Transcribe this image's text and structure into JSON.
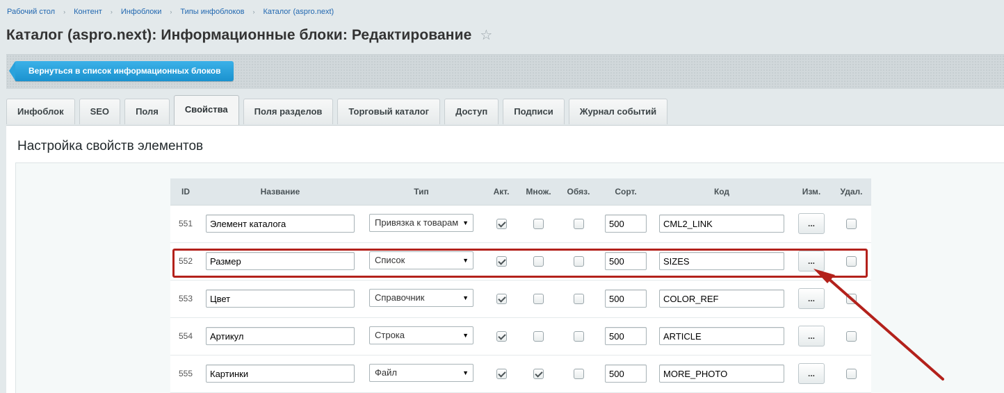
{
  "breadcrumb": [
    "Рабочий стол",
    "Контент",
    "Инфоблоки",
    "Типы инфоблоков",
    "Каталог (aspro.next)"
  ],
  "breadcrumb_separator": "›",
  "title": "Каталог (aspro.next): Информационные блоки: Редактирование",
  "favorite_icon": "☆",
  "toolbar": {
    "back_label": "Вернуться в список информационных блоков"
  },
  "tabs": [
    {
      "label": "Инфоблок"
    },
    {
      "label": "SEO"
    },
    {
      "label": "Поля"
    },
    {
      "label": "Свойства",
      "active": true
    },
    {
      "label": "Поля разделов"
    },
    {
      "label": "Торговый каталог"
    },
    {
      "label": "Доступ"
    },
    {
      "label": "Подписи"
    },
    {
      "label": "Журнал событий"
    }
  ],
  "section_title": "Настройка свойств элементов",
  "table": {
    "headers": {
      "id": "ID",
      "name": "Название",
      "type": "Тип",
      "active": "Акт.",
      "multiple": "Множ.",
      "required": "Обяз.",
      "sort": "Сорт.",
      "code": "Код",
      "edit": "Изм.",
      "delete": "Удал."
    },
    "edit_button_label": "...",
    "rows": [
      {
        "id": "551",
        "name": "Элемент каталога",
        "type": "Привязка к товарам",
        "active": true,
        "multiple": false,
        "required": false,
        "sort": "500",
        "code": "CML2_LINK"
      },
      {
        "id": "552",
        "name": "Размер",
        "type": "Список",
        "active": true,
        "multiple": false,
        "required": false,
        "sort": "500",
        "code": "SIZES",
        "highlighted": true
      },
      {
        "id": "553",
        "name": "Цвет",
        "type": "Справочник",
        "active": true,
        "multiple": false,
        "required": false,
        "sort": "500",
        "code": "COLOR_REF"
      },
      {
        "id": "554",
        "name": "Артикул",
        "type": "Строка",
        "active": true,
        "multiple": false,
        "required": false,
        "sort": "500",
        "code": "ARTICLE"
      },
      {
        "id": "555",
        "name": "Картинки",
        "type": "Файл",
        "active": true,
        "multiple": true,
        "required": false,
        "sort": "500",
        "code": "MORE_PHOTO"
      }
    ]
  },
  "colors": {
    "accent": "#1b92cf",
    "highlight": "#b3211b"
  }
}
